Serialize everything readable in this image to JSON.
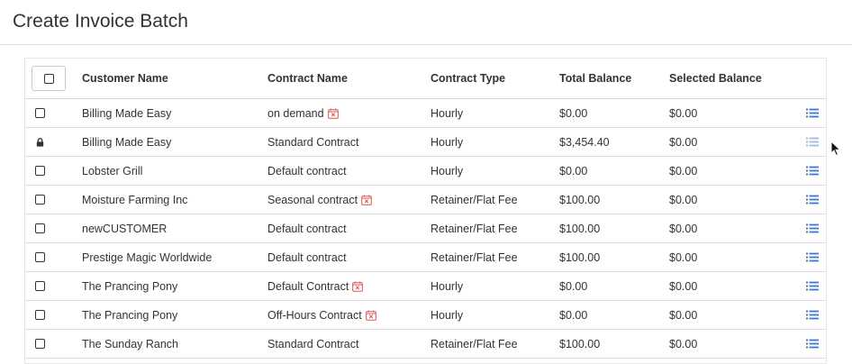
{
  "page": {
    "title": "Create Invoice Batch"
  },
  "colors": {
    "accent": "#3a7bc8",
    "muted_accent": "#9fbde3",
    "calendar_red": "#d9534f"
  },
  "table": {
    "headers": {
      "customer": "Customer Name",
      "contract": "Contract Name",
      "type": "Contract Type",
      "total": "Total Balance",
      "selected": "Selected Balance"
    },
    "rows": [
      {
        "customer": "Billing Made Easy",
        "contract": "on demand",
        "calendar": true,
        "type": "Hourly",
        "total": "$0.00",
        "selected": "$0.00",
        "locked": false
      },
      {
        "customer": "Billing Made Easy",
        "contract": "Standard Contract",
        "calendar": false,
        "type": "Hourly",
        "total": "$3,454.40",
        "selected": "$0.00",
        "locked": true
      },
      {
        "customer": "Lobster Grill",
        "contract": "Default contract",
        "calendar": false,
        "type": "Hourly",
        "total": "$0.00",
        "selected": "$0.00",
        "locked": false
      },
      {
        "customer": "Moisture Farming Inc",
        "contract": "Seasonal contract",
        "calendar": true,
        "type": "Retainer/Flat Fee",
        "total": "$100.00",
        "selected": "$0.00",
        "locked": false
      },
      {
        "customer": "newCUSTOMER",
        "contract": "Default contract",
        "calendar": false,
        "type": "Retainer/Flat Fee",
        "total": "$100.00",
        "selected": "$0.00",
        "locked": false
      },
      {
        "customer": "Prestige Magic Worldwide",
        "contract": "Default contract",
        "calendar": false,
        "type": "Retainer/Flat Fee",
        "total": "$100.00",
        "selected": "$0.00",
        "locked": false
      },
      {
        "customer": "The Prancing Pony",
        "contract": "Default Contract",
        "calendar": true,
        "type": "Hourly",
        "total": "$0.00",
        "selected": "$0.00",
        "locked": false
      },
      {
        "customer": "The Prancing Pony",
        "contract": "Off-Hours Contract",
        "calendar": true,
        "type": "Hourly",
        "total": "$0.00",
        "selected": "$0.00",
        "locked": false
      },
      {
        "customer": "The Sunday Ranch",
        "contract": "Standard Contract",
        "calendar": false,
        "type": "Retainer/Flat Fee",
        "total": "$100.00",
        "selected": "$0.00",
        "locked": false
      }
    ]
  },
  "icons": {
    "row_select": "checkbox-icon",
    "locked": "lock-icon",
    "calendar": "calendar-x-icon",
    "details": "list-icon"
  }
}
